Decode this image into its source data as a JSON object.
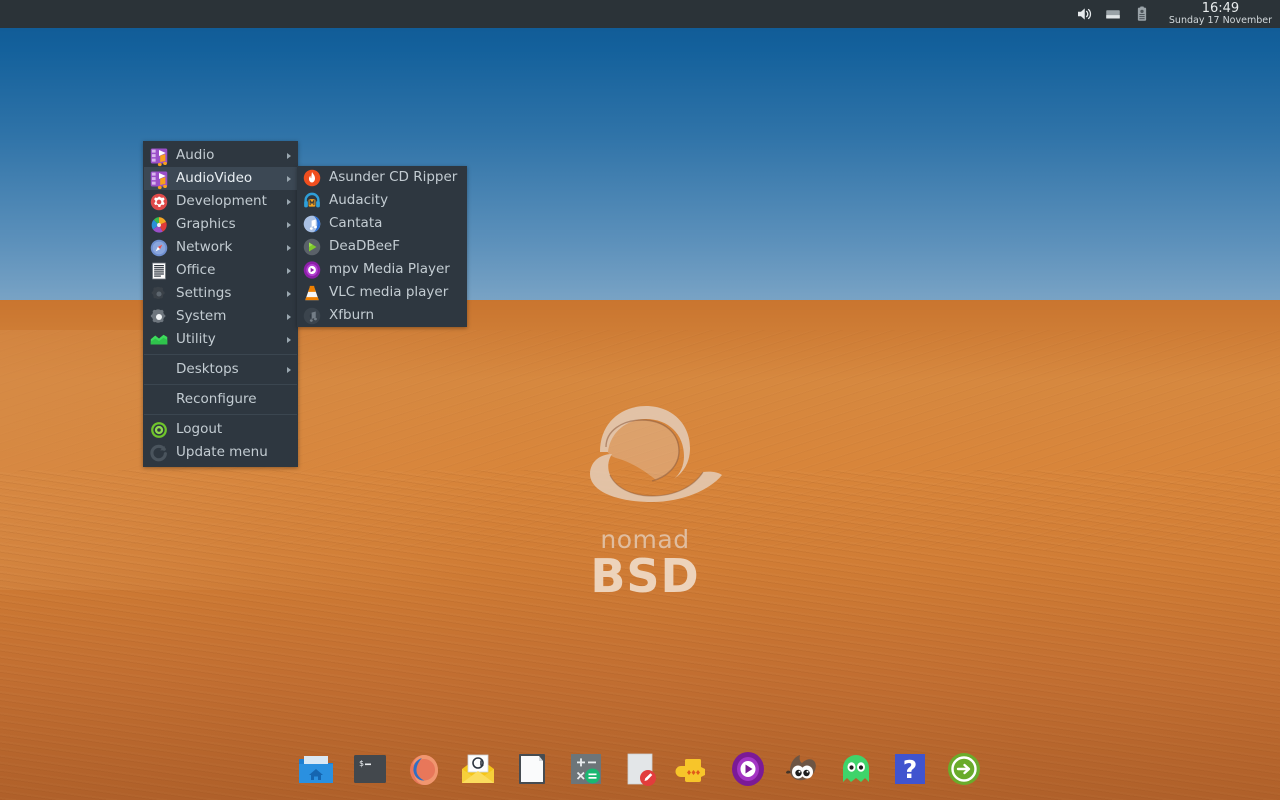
{
  "desktop": {
    "os_name": "nomadBSD",
    "logo_line1": "nomad",
    "logo_line2": "BSD",
    "wallpaper": "desert-dune-photo",
    "sky_top_color": "#0d5793",
    "sky_horizon_color": "#b5c8d8",
    "sand_top_color": "#d6883f",
    "sand_bottom_color": "#b9672e"
  },
  "top_panel": {
    "background_color": "#2b3338",
    "clock": {
      "time": "16:49",
      "date": "Sunday 17 November"
    },
    "tray_icons": [
      {
        "name": "volume-icon",
        "label": "Volume"
      },
      {
        "name": "display-icon",
        "label": "Display"
      },
      {
        "name": "battery-icon",
        "label": "Battery"
      }
    ]
  },
  "root_menu": {
    "background_color": "#2e3740",
    "highlight_color": "#3c4854",
    "text_color": "#c3ccd2",
    "items": [
      {
        "label": "Audio",
        "icon": "audio-icon",
        "submenu": true,
        "selected": false
      },
      {
        "label": "AudioVideo",
        "icon": "audiovideo-icon",
        "submenu": true,
        "selected": true
      },
      {
        "label": "Development",
        "icon": "development-icon",
        "submenu": true,
        "selected": false
      },
      {
        "label": "Graphics",
        "icon": "graphics-icon",
        "submenu": true,
        "selected": false
      },
      {
        "label": "Network",
        "icon": "network-icon",
        "submenu": true,
        "selected": false
      },
      {
        "label": "Office",
        "icon": "office-icon",
        "submenu": true,
        "selected": false
      },
      {
        "label": "Settings",
        "icon": "settings-icon",
        "submenu": true,
        "selected": false
      },
      {
        "label": "System",
        "icon": "system-icon",
        "submenu": true,
        "selected": false
      },
      {
        "label": "Utility",
        "icon": "utility-icon",
        "submenu": true,
        "selected": false
      }
    ],
    "extra_items": [
      {
        "label": "Desktops",
        "icon": "none",
        "submenu": true,
        "selected": false
      },
      {
        "label": "Reconfigure",
        "icon": "none",
        "submenu": false,
        "selected": false
      },
      {
        "label": "Logout",
        "icon": "logout-icon",
        "submenu": false,
        "selected": false
      },
      {
        "label": "Update menu",
        "icon": "refresh-icon",
        "submenu": false,
        "selected": false
      }
    ]
  },
  "sub_menu": {
    "parent": "AudioVideo",
    "items": [
      {
        "label": "Asunder CD Ripper",
        "icon": "asunder-icon"
      },
      {
        "label": "Audacity",
        "icon": "audacity-icon"
      },
      {
        "label": "Cantata",
        "icon": "cantata-icon"
      },
      {
        "label": "DeaDBeeF",
        "icon": "deadbeef-icon"
      },
      {
        "label": "mpv Media Player",
        "icon": "mpv-icon"
      },
      {
        "label": "VLC media player",
        "icon": "vlc-icon"
      },
      {
        "label": "Xfburn",
        "icon": "xfburn-icon"
      }
    ]
  },
  "dock": {
    "items": [
      {
        "name": "file-manager-icon",
        "label": "File Manager"
      },
      {
        "name": "terminal-icon",
        "label": "Terminal"
      },
      {
        "name": "firefox-icon",
        "label": "Firefox"
      },
      {
        "name": "mail-icon",
        "label": "Mail"
      },
      {
        "name": "writer-icon",
        "label": "Writer"
      },
      {
        "name": "calculator-icon",
        "label": "Calculator"
      },
      {
        "name": "text-editor-icon",
        "label": "Text Editor"
      },
      {
        "name": "teapot-icon",
        "label": "Teapot"
      },
      {
        "name": "mpv-icon",
        "label": "mpv"
      },
      {
        "name": "gimp-icon",
        "label": "GIMP"
      },
      {
        "name": "ghost-icon",
        "label": "Ghost"
      },
      {
        "name": "help-icon",
        "label": "Help"
      },
      {
        "name": "logout-icon",
        "label": "Logout"
      }
    ]
  }
}
